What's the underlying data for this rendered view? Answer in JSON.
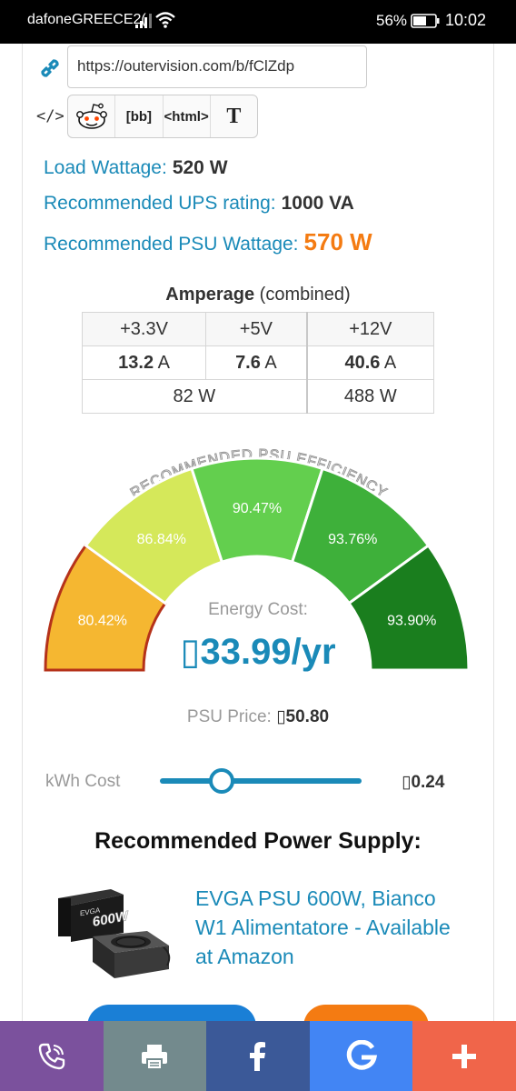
{
  "status_bar": {
    "carrier": "dafoneGREECE2(",
    "battery_percent": "56%",
    "time": "10:02"
  },
  "share": {
    "url": "https://outervision.com/b/fClZdp",
    "embed_buttons": [
      "reddit",
      "[bb]",
      "<html>",
      "T"
    ]
  },
  "results": {
    "load_wattage_label": "Load Wattage:",
    "load_wattage_value": "520 W",
    "ups_label": "Recommended UPS rating:",
    "ups_value": "1000 VA",
    "psu_label": "Recommended PSU Wattage:",
    "psu_value": "570 W"
  },
  "amperage": {
    "title_bold": "Amperage",
    "title_rest": "(combined)",
    "headers": [
      "+3.3V",
      "+5V",
      "+12V"
    ],
    "amps": [
      {
        "value": "13.2",
        "unit": "A"
      },
      {
        "value": "7.6",
        "unit": "A"
      },
      {
        "value": "40.6",
        "unit": "A"
      }
    ],
    "watts_low": "82 W",
    "watts_12v": "488 W"
  },
  "efficiency": {
    "title": "RECOMMENDED PSU EFFICIENCY",
    "segments": [
      {
        "label": "80.42%",
        "color": "#f5b731"
      },
      {
        "label": "86.84%",
        "color": "#d5e85a"
      },
      {
        "label": "90.47%",
        "color": "#63cf4e"
      },
      {
        "label": "93.76%",
        "color": "#3eb03a"
      },
      {
        "label": "93.90%",
        "color": "#1a7e1e"
      }
    ],
    "selected_index": 0
  },
  "energy": {
    "label": "Energy Cost:",
    "value": "▯33.99/yr",
    "psu_price_label": "PSU Price:",
    "psu_price_value": "▯50.80"
  },
  "kwh": {
    "label": "kWh Cost",
    "value": "▯0.24",
    "slider_fraction": 0.29
  },
  "recommended": {
    "title": "Recommended Power Supply:",
    "product_text": "EVGA PSU 600W, Bianco W1 Alimentatore - Available at Amazon",
    "product_box_text": "600W"
  },
  "sharebar": [
    {
      "name": "viber",
      "color": "#7b519d"
    },
    {
      "name": "print",
      "color": "#738a8d"
    },
    {
      "name": "facebook",
      "color": "#3b5998"
    },
    {
      "name": "google",
      "color": "#4285f4"
    },
    {
      "name": "more",
      "color": "#f0654a"
    }
  ],
  "colors": {
    "accent": "#1a8ab8",
    "highlight": "#f47b12"
  }
}
